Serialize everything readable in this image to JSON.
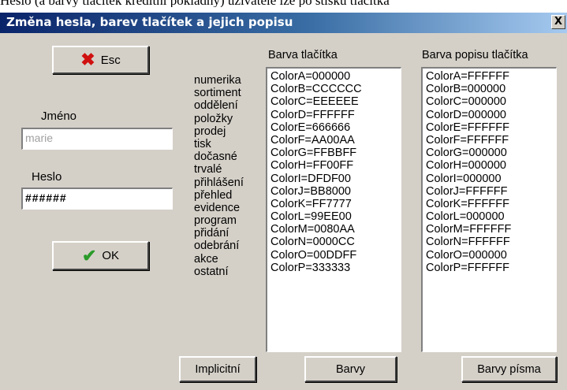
{
  "top_text": "Heslo (a barvy tlačítek kreditní pokladny) uživatele lze po stisku tlačítka",
  "window": {
    "title": "Změna hesla, barev tlačítek a jejich popisu",
    "close_label": "X"
  },
  "buttons": {
    "esc_label": "Esc",
    "ok_label": "OK",
    "implicit_label": "Implicitní",
    "colors_label": "Barvy",
    "font_colors_label": "Barvy písma"
  },
  "fields": {
    "name_label": "Jméno",
    "name_value": "marie",
    "password_label": "Heslo",
    "password_value": "######"
  },
  "lists": {
    "button_color_header": "Barva tlačítka",
    "caption_color_header": "Barva popisu tlačítka",
    "names": [
      "numerika",
      "sortiment",
      "oddělení",
      "položky",
      "prodej",
      "tisk",
      "dočasné",
      "trvalé",
      "přihlášení",
      "přehled",
      "evidence",
      "program",
      "přidání",
      "odebrání",
      "akce",
      "ostatní"
    ],
    "button_colors": [
      "ColorA=000000",
      "ColorB=CCCCCC",
      "ColorC=EEEEEE",
      "ColorD=FFFFFF",
      "ColorE=666666",
      "ColorF=AA00AA",
      "ColorG=FFBBFF",
      "ColorH=FF00FF",
      "ColorI=DFDF00",
      "ColorJ=BB8000",
      "ColorK=FF7777",
      "ColorL=99EE00",
      "ColorM=0080AA",
      "ColorN=0000CC",
      "ColorO=00DDFF",
      "ColorP=333333"
    ],
    "caption_colors": [
      "ColorA=FFFFFF",
      "ColorB=000000",
      "ColorC=000000",
      "ColorD=000000",
      "ColorE=FFFFFF",
      "ColorF=FFFFFF",
      "ColorG=000000",
      "ColorH=000000",
      "ColorI=000000",
      "ColorJ=FFFFFF",
      "ColorK=FFFFFF",
      "ColorL=000000",
      "ColorM=FFFFFF",
      "ColorN=FFFFFF",
      "ColorO=000000",
      "ColorP=FFFFFF"
    ]
  },
  "colors": {
    "title_bar_start": "#0a246a",
    "title_bar_end": "#a6caf0",
    "dialog_bg": "#d4d0c8",
    "esc_icon": "#d01010",
    "ok_icon": "#2a9a2a"
  },
  "icons": {
    "esc": "x-icon",
    "ok": "checkmark-icon"
  }
}
